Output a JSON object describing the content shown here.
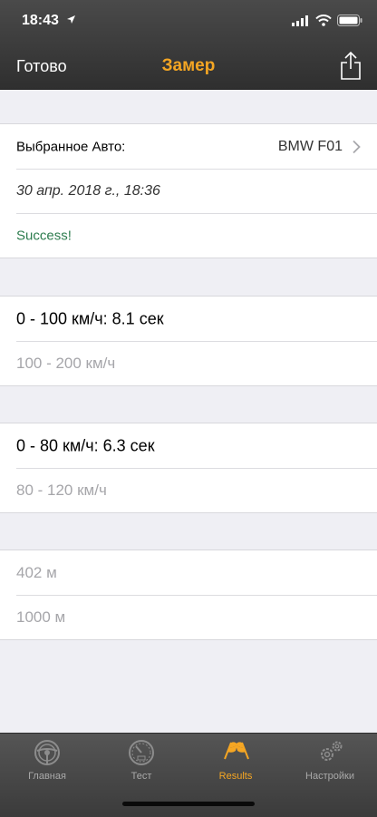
{
  "status_bar": {
    "time": "18:43"
  },
  "nav": {
    "done_label": "Готово",
    "title": "Замер"
  },
  "info": {
    "car_label": "Выбранное Авто:",
    "car_value": "BMW F01",
    "date": "30 апр. 2018 г., 18:36",
    "status": "Success!"
  },
  "results": {
    "r1": "0 - 100 км/ч: 8.1 сек",
    "r2": "100 - 200 км/ч",
    "r3": "0 - 80 км/ч: 6.3 сек",
    "r4": "80 - 120 км/ч",
    "r5": "402 м",
    "r6": "1000 м"
  },
  "tabs": [
    {
      "label": "Главная",
      "icon": "steering-wheel-icon"
    },
    {
      "label": "Тест",
      "icon": "speedometer-icon"
    },
    {
      "label": "Results",
      "icon": "checkered-flags-icon",
      "active": true
    },
    {
      "label": "Настройки",
      "icon": "gears-icon"
    }
  ],
  "colors": {
    "accent": "#f5a623",
    "success": "#2e7d4f",
    "bar": "#3b3b3b"
  }
}
